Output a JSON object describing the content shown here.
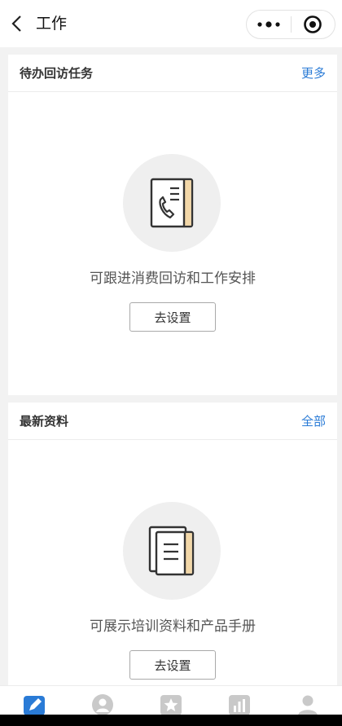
{
  "nav": {
    "title": "工作",
    "back_icon": "chevron-left-icon",
    "more_icon": "more-dots-icon",
    "close_icon": "target-icon"
  },
  "cards": [
    {
      "title": "待办回访任务",
      "link": "更多",
      "empty_icon": "phone-book-icon",
      "empty_text": "可跟进消费回访和工作安排",
      "button": "去设置"
    },
    {
      "title": "最新资料",
      "link": "全部",
      "empty_icon": "documents-icon",
      "empty_text": "可展示培训资料和产品手册",
      "button": "去设置"
    }
  ],
  "tabbar": {
    "active_color": "#2a7bd6",
    "inactive_color": "#c9c9c9",
    "items": [
      {
        "icon": "pencil-icon",
        "active": true
      },
      {
        "icon": "customer-icon",
        "active": false
      },
      {
        "icon": "star-icon",
        "active": false
      },
      {
        "icon": "chart-icon",
        "active": false
      },
      {
        "icon": "person-icon",
        "active": false
      }
    ]
  },
  "colors": {
    "link": "#2a7bd6",
    "page_bg": "#f2f2f2",
    "card_bg": "#ffffff"
  }
}
